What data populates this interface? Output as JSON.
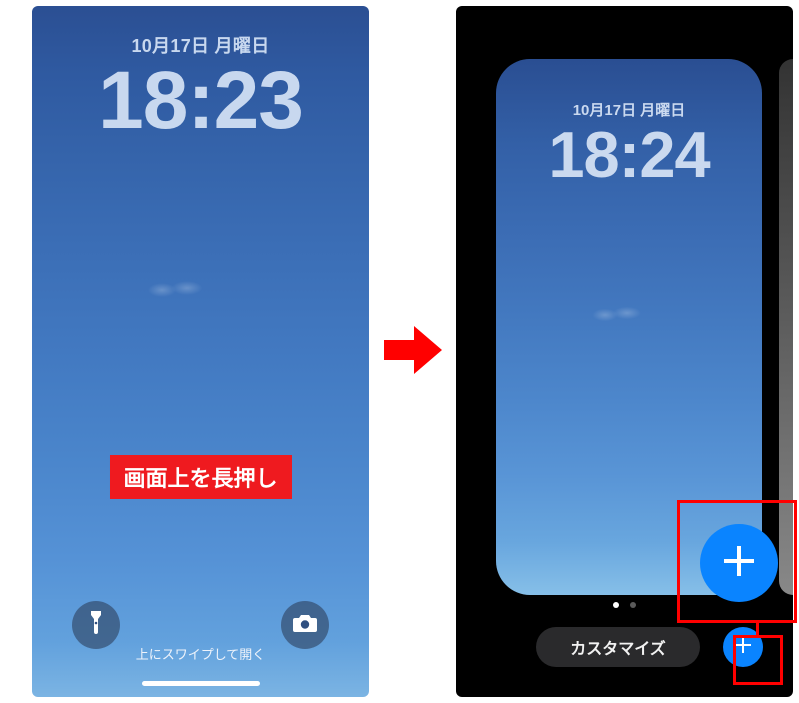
{
  "left": {
    "date": "10月17日 月曜日",
    "time": "18:23",
    "swipe_hint": "上にスワイプして開く",
    "callout": "画面上を長押し",
    "icons": {
      "flashlight": "flashlight-icon",
      "camera": "camera-icon"
    }
  },
  "transition_arrow": "→",
  "right": {
    "preview": {
      "date": "10月17日 月曜日",
      "time": "18:24"
    },
    "pager": {
      "current": 1,
      "total": 2
    },
    "customize_label": "カスタマイズ",
    "add_button": "+",
    "add_big_button": "+"
  },
  "colors": {
    "accent_blue": "#0a84ff",
    "callout_red": "#ef1a1f",
    "highlight_red": "#ff0000"
  }
}
